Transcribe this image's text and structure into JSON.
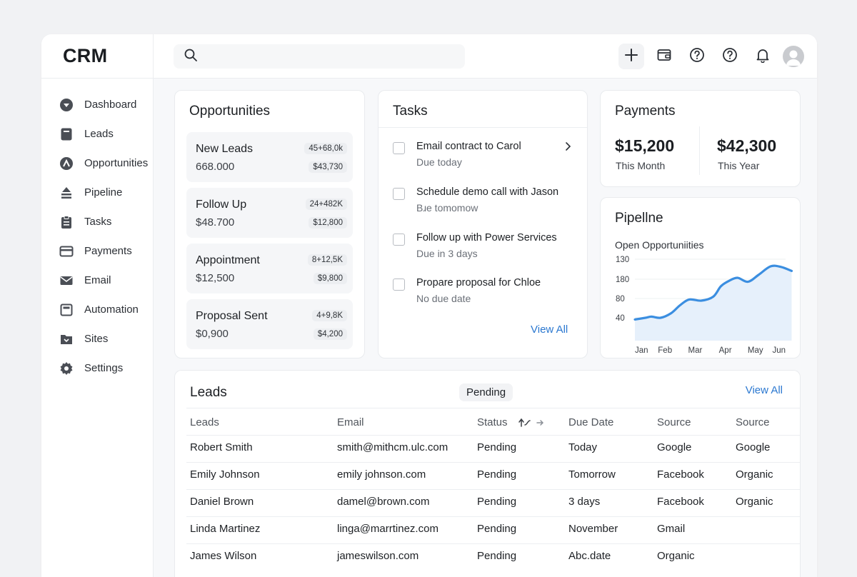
{
  "app": {
    "brand": "CRM"
  },
  "sidebar": {
    "items": [
      {
        "label": "Dashboard",
        "icon": "dashboard-icon"
      },
      {
        "label": "Leads",
        "icon": "leads-icon"
      },
      {
        "label": "Opportunities",
        "icon": "opportunities-icon"
      },
      {
        "label": "Pipeline",
        "icon": "pipeline-icon"
      },
      {
        "label": "Tasks",
        "icon": "tasks-icon"
      },
      {
        "label": "Payments",
        "icon": "payments-icon"
      },
      {
        "label": "Email",
        "icon": "email-icon"
      },
      {
        "label": "Automation",
        "icon": "automation-icon"
      },
      {
        "label": "Sites",
        "icon": "sites-icon"
      },
      {
        "label": "Settings",
        "icon": "gear-icon"
      }
    ]
  },
  "topbar": {
    "search_placeholder": "",
    "actions": [
      "plus-icon",
      "wallet-icon",
      "help-icon",
      "help-icon",
      "bell-icon",
      "avatar"
    ]
  },
  "opportunities": {
    "title": "Opportunities",
    "items": [
      {
        "name": "New Leads",
        "value": "668.000",
        "badge1": "45+68,0k",
        "badge2": "$43,730"
      },
      {
        "name": "Follow Up",
        "value": "$48.700",
        "badge1": "24+482K",
        "badge2": "$12,800"
      },
      {
        "name": "Appointment",
        "value": "$12,500",
        "badge1": "8+12,5K",
        "badge2": "$9,800"
      },
      {
        "name": "Proposal Sent",
        "value": "$0,900",
        "badge1": "4+9,8K",
        "badge2": "$4,200"
      }
    ]
  },
  "tasks": {
    "title": "Tasks",
    "items": [
      {
        "title": "Email contract to Carol",
        "sub": "Due today"
      },
      {
        "title": "Schedule demo call with Jason",
        "sub": "Bɹe tomomow"
      },
      {
        "title": "Follow up with Power Services",
        "sub": "Due in 3 days"
      },
      {
        "title": "Propare proposal for Chloe",
        "sub": "No due date"
      }
    ],
    "view_all": "View All"
  },
  "payments": {
    "title": "Payments",
    "month_amount": "$15,200",
    "month_label": "This Month",
    "year_amount": "$42,300",
    "year_label": "This Year"
  },
  "pipeline": {
    "title": "Pipellne",
    "subtitle": "Open Opportuniities"
  },
  "chart_data": {
    "type": "area",
    "title": "",
    "xlabel": "",
    "ylabel": "",
    "categories": [
      "Jan",
      "Feb",
      "Mar",
      "Apr",
      "May",
      "Jun"
    ],
    "y_tick_labels": [
      "130",
      "180",
      "80",
      "40"
    ],
    "x": [
      0,
      0.35,
      0.55,
      0.85,
      1.2,
      1.5,
      1.8,
      2.2,
      2.6,
      2.85,
      3.1,
      3.4,
      3.75,
      4.1,
      4.5,
      4.85,
      5.2
    ],
    "values": [
      37,
      40,
      42,
      40,
      48,
      62,
      72,
      70,
      77,
      95,
      104,
      110,
      103,
      115,
      130,
      129,
      122
    ],
    "ylim": [
      0,
      150
    ],
    "color": "#3b8ee0",
    "fill_color": "#e6f0fb",
    "grid": true
  },
  "leads": {
    "title": "Leads",
    "filter": "Pending",
    "view_all": "View All",
    "columns": [
      "Leads",
      "Email",
      "Status",
      "Due Date",
      "Source",
      "Source"
    ],
    "rows": [
      [
        "Robert Smith",
        "smith@mithcm.ulc.com",
        "Pending",
        "Today",
        "Google",
        "Google"
      ],
      [
        "Emily Johnson",
        "emily johnson.com",
        "Pending",
        "Tomorrow",
        "Facebook",
        "Organic"
      ],
      [
        "Daniel Brown",
        "damel@brown.com",
        "Pending",
        "3 days",
        "Facebook",
        "Organic"
      ],
      [
        "Linda Martinez",
        "linga@marrtinez.com",
        "Pending",
        "November",
        "Gmail",
        ""
      ],
      [
        "James Wilson",
        "jameswilson.com",
        "Pending",
        "Abc.date",
        "Organic",
        ""
      ]
    ]
  }
}
